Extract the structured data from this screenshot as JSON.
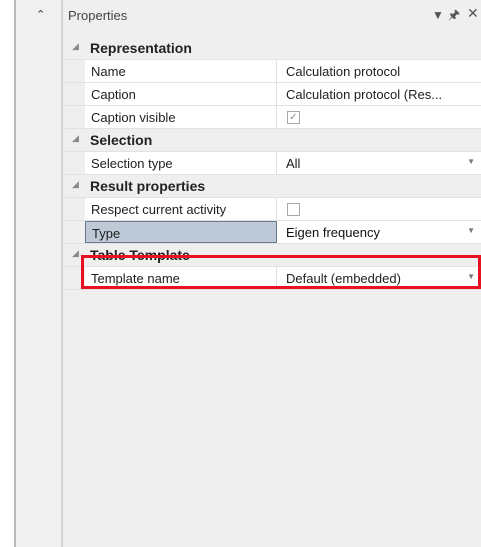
{
  "panel": {
    "title": "Properties",
    "icons": [
      "dropdown-icon",
      "pin-icon",
      "close-icon"
    ]
  },
  "grid": {
    "categories": [
      {
        "label": "Representation",
        "properties": [
          {
            "name": "Name",
            "value": "Calculation protocol"
          },
          {
            "name": "Caption",
            "value": "Calculation protocol (Res..."
          },
          {
            "name": "Caption visible",
            "value": "",
            "checkbox": true,
            "checked": true
          }
        ]
      },
      {
        "label": "Selection",
        "properties": [
          {
            "name": "Selection type",
            "value": "All",
            "dropdown": true
          }
        ]
      },
      {
        "label": "Result properties",
        "properties": [
          {
            "name": "Respect current activity",
            "value": "",
            "checkbox": true,
            "checked": false
          },
          {
            "name": "Type",
            "value": "Eigen frequency",
            "dropdown": true,
            "selected": true
          }
        ]
      },
      {
        "label": "Table Template",
        "properties": [
          {
            "name": "Template name",
            "value": "Default (embedded)",
            "dropdown": true
          }
        ]
      }
    ]
  },
  "highlight_color": "#e8111f"
}
